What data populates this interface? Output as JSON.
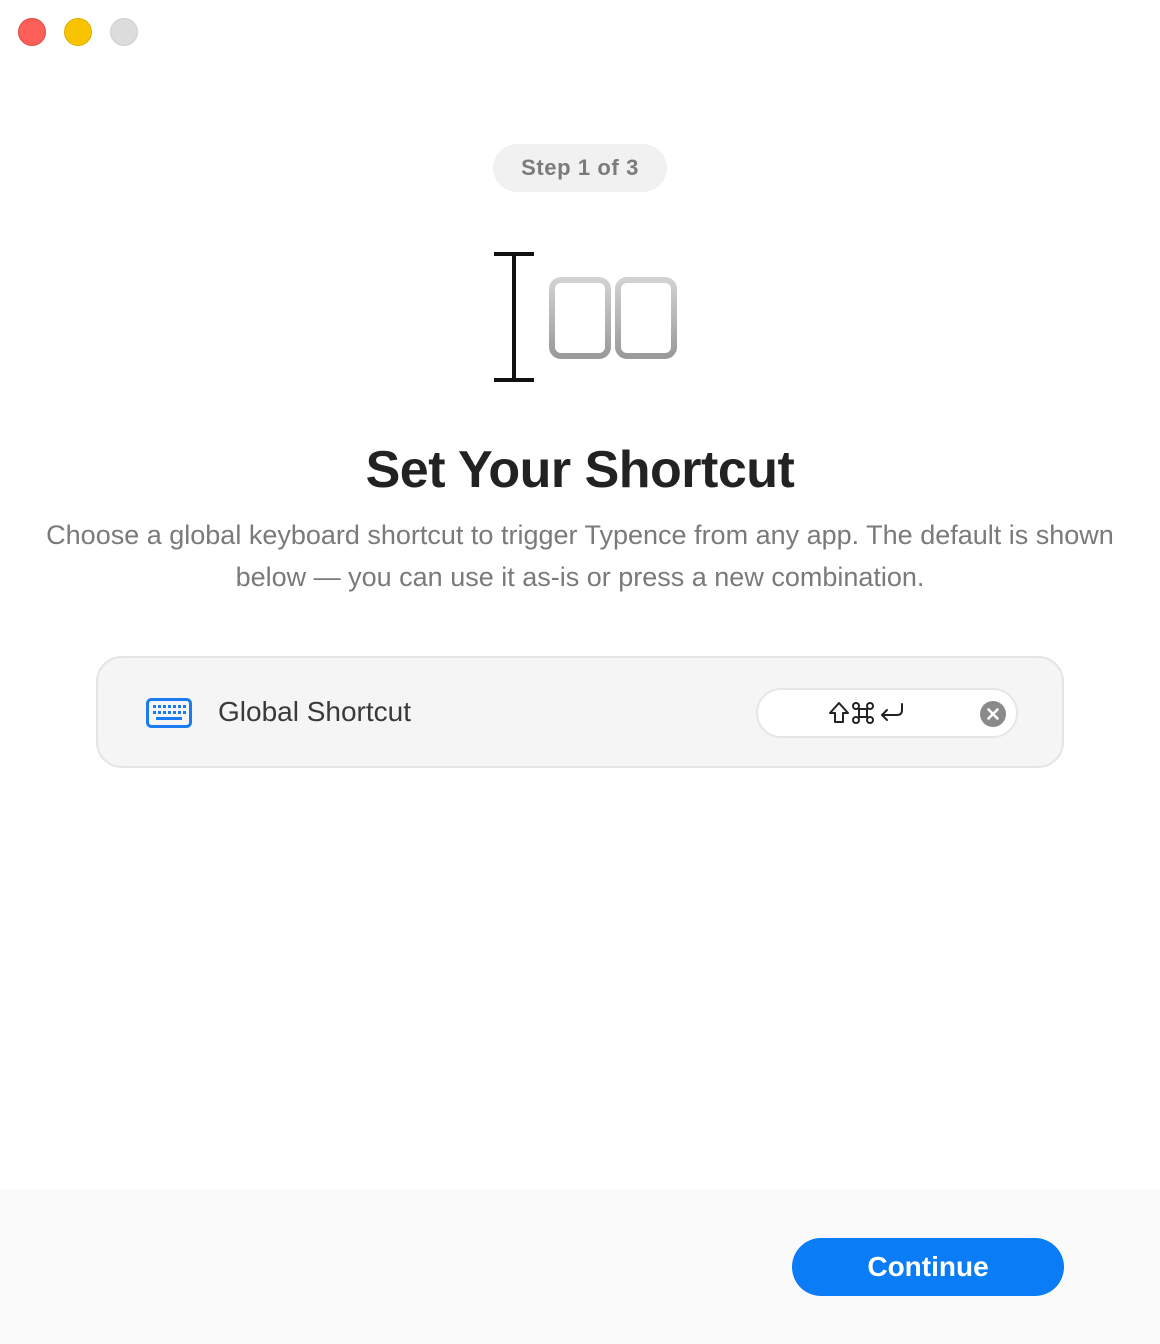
{
  "window": {
    "controls": [
      "close",
      "minimize",
      "zoom"
    ]
  },
  "onboarding": {
    "step_label": "Step 1 of 3",
    "hero_icon": "text-cursor-with-key-caps-icon",
    "title": "Set Your Shortcut",
    "description": "Choose a global keyboard shortcut to trigger Typence from any app. The default is shown below — you can use it as-is or press a new combination."
  },
  "shortcut": {
    "icon": "keyboard-icon",
    "label": "Global Shortcut",
    "value": "⇧⌘↩",
    "clear_icon": "clear-x-icon"
  },
  "footer": {
    "continue_label": "Continue"
  },
  "colors": {
    "accent": "#0a7cf5",
    "close": "#fe5f57",
    "minimize": "#f8c400",
    "zoom": "#dcdcdc"
  }
}
